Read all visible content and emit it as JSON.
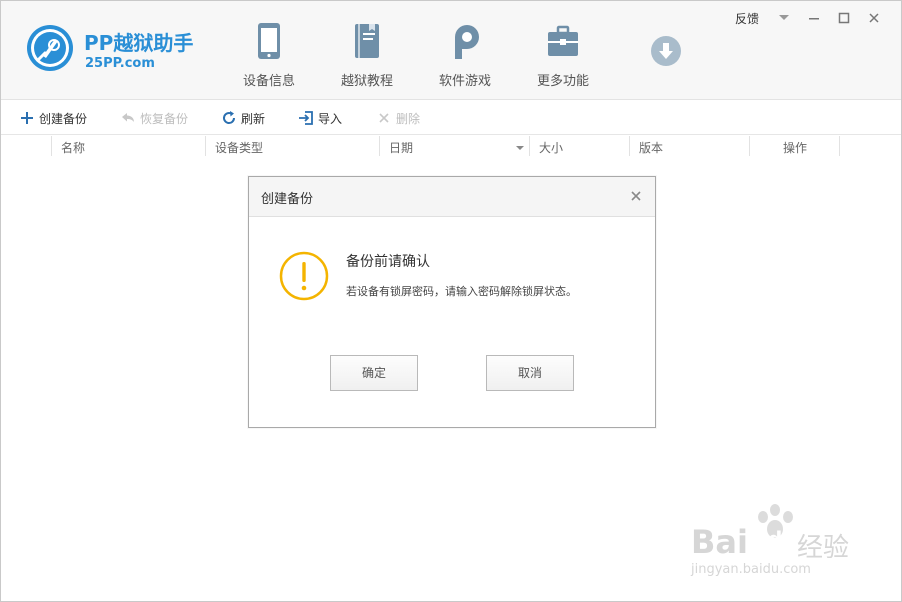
{
  "app": {
    "name": "PP越狱助手",
    "url": "25PP.com"
  },
  "nav": [
    {
      "label": "设备信息",
      "icon": "phone-icon"
    },
    {
      "label": "越狱教程",
      "icon": "book-icon"
    },
    {
      "label": "软件游戏",
      "icon": "pp-app-icon"
    },
    {
      "label": "更多功能",
      "icon": "toolbox-icon"
    }
  ],
  "window": {
    "feedback": "反馈"
  },
  "toolbar": {
    "create_backup": "创建备份",
    "restore_backup": "恢复备份",
    "refresh": "刷新",
    "import": "导入",
    "delete": "删除"
  },
  "table": {
    "columns": [
      "名称",
      "设备类型",
      "日期",
      "大小",
      "版本",
      "操作"
    ]
  },
  "dialog": {
    "title": "创建备份",
    "heading": "备份前请确认",
    "message": "若设备有锁屏密码，请输入密码解除锁屏状态。",
    "confirm": "确定",
    "cancel": "取消"
  },
  "watermark": {
    "brand": "Bai",
    "brand_mid": "du",
    "brand_cn": "经验",
    "url": "jingyan.baidu.com"
  },
  "colors": {
    "accent": "#2a8fd6",
    "nav_icon": "#6f8fa8",
    "warning": "#f4b400"
  }
}
